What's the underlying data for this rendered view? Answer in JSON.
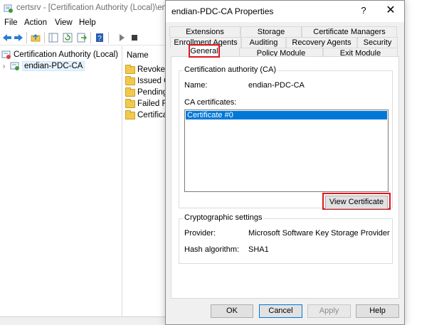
{
  "mmc": {
    "title": "certsrv - [Certification Authority (Local)\\endian",
    "menu": [
      "File",
      "Action",
      "View",
      "Help"
    ],
    "tree": {
      "root": "Certification Authority (Local)",
      "child": "endian-PDC-CA"
    },
    "list": {
      "header": "Name",
      "items": [
        "Revoked",
        "Issued Ce",
        "Pending",
        "Failed Re",
        "Certificat"
      ]
    }
  },
  "dialog": {
    "title": "endian-PDC-CA Properties",
    "help_glyph": "?",
    "close_glyph": "✕",
    "tabs_row1": [
      "Extensions",
      "Storage",
      "Certificate Managers"
    ],
    "tabs_row2": [
      "Enrollment Agents",
      "Auditing",
      "Recovery Agents",
      "Security"
    ],
    "tabs_row3": [
      "General",
      "Policy Module",
      "Exit Module"
    ],
    "ca_group": {
      "caption": "Certification authority (CA)",
      "name_label": "Name:",
      "name_value": "endian-PDC-CA",
      "certs_label": "CA certificates:",
      "certs": [
        "Certificate #0"
      ],
      "view_button": "View Certificate"
    },
    "crypto_group": {
      "caption": "Cryptographic settings",
      "provider_label": "Provider:",
      "provider_value": "Microsoft Software Key Storage Provider",
      "hash_label": "Hash algorithm:",
      "hash_value": "SHA1"
    },
    "buttons": {
      "ok": "OK",
      "cancel": "Cancel",
      "apply": "Apply",
      "help": "Help"
    }
  },
  "colors": {
    "highlight_red": "#e0161b",
    "selection_blue": "#0078d7",
    "dialog_face": "#f0f0f0"
  }
}
